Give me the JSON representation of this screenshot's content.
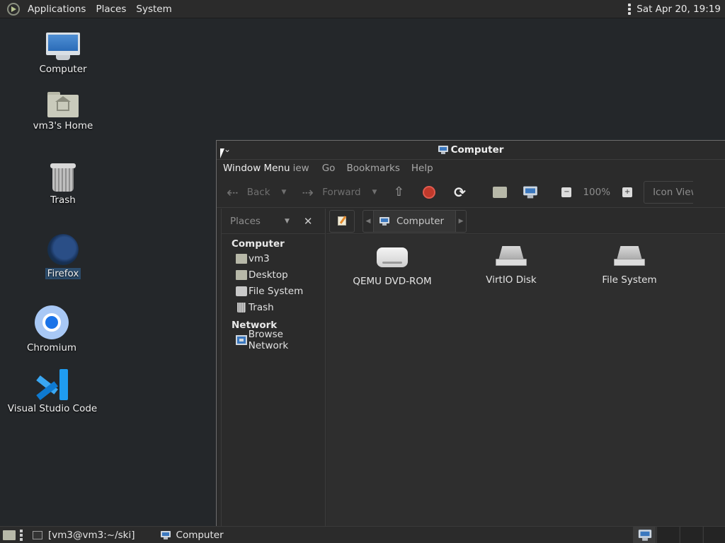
{
  "top_panel": {
    "menus": [
      "Applications",
      "Places",
      "System"
    ],
    "clock": "Sat Apr 20, 19:19"
  },
  "desktop": {
    "icons": [
      {
        "label": "Computer",
        "icon": "computer-icon"
      },
      {
        "label": "vm3's Home",
        "icon": "home-folder-icon"
      },
      {
        "label": "Trash",
        "icon": "trash-icon"
      },
      {
        "label": "Firefox",
        "icon": "firefox-icon",
        "selected": true
      },
      {
        "label": "Chromium",
        "icon": "chromium-icon"
      },
      {
        "label": "Visual Studio Code",
        "icon": "vscode-icon"
      }
    ]
  },
  "window": {
    "title": "Computer",
    "menubar": [
      "Window Menu",
      "iew",
      "Go",
      "Bookmarks",
      "Help"
    ],
    "toolbar": {
      "back": "Back",
      "forward": "Forward",
      "zoom": "100%",
      "view": "Icon View"
    },
    "sidebar": {
      "header": "Places",
      "groups": [
        {
          "title": "Computer",
          "items": [
            "vm3",
            "Desktop",
            "File System",
            "Trash"
          ]
        },
        {
          "title": "Network",
          "items": [
            "Browse Network"
          ]
        }
      ]
    },
    "pathbar": {
      "crumb": "Computer"
    },
    "items": [
      {
        "label": "QEMU DVD-ROM",
        "icon": "dvd-drive-icon"
      },
      {
        "label": "VirtIO Disk",
        "icon": "hard-disk-icon"
      },
      {
        "label": "File System",
        "icon": "hard-disk-icon"
      }
    ]
  },
  "bottom_panel": {
    "tasks": [
      "[vm3@vm3:~/ski]",
      "Computer"
    ]
  }
}
